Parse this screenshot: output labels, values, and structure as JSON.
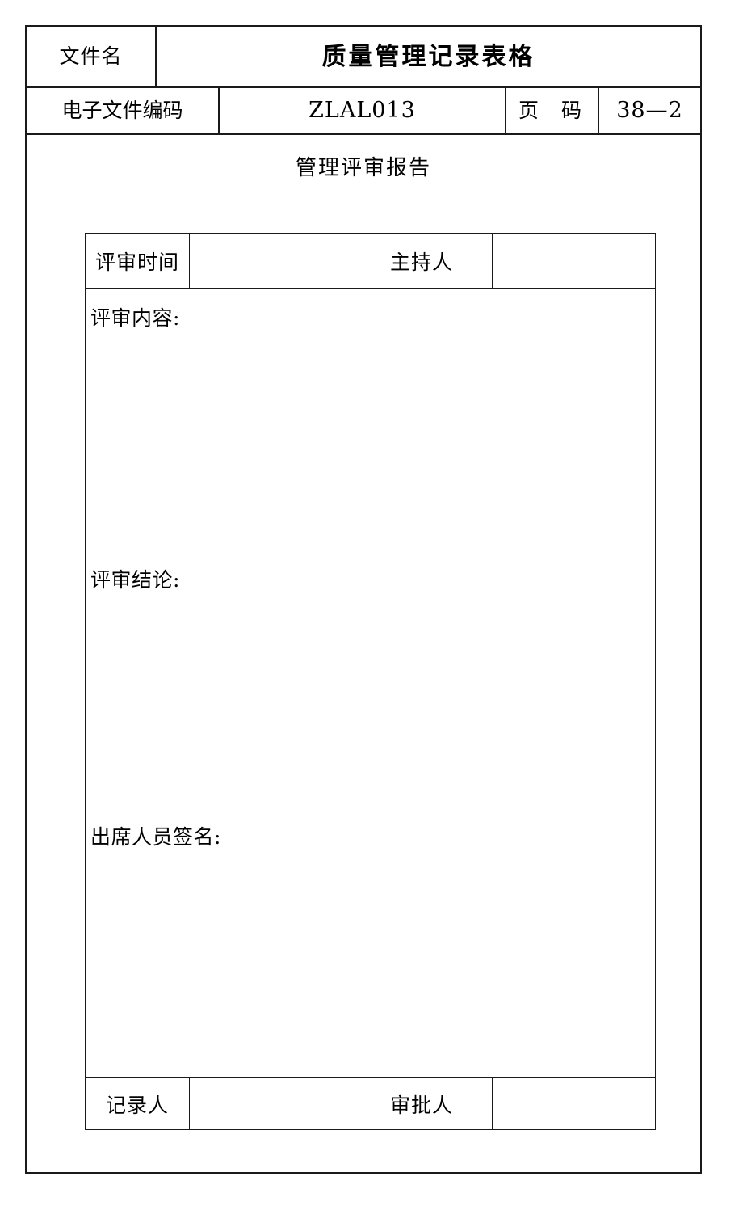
{
  "document": {
    "header": {
      "doc_name_label": "文件名",
      "doc_name_value": "质量管理记录表格",
      "code_label": "电子文件编码",
      "code_value": "ZLAL013",
      "page_label": "页 码",
      "page_label_first": "页",
      "page_label_second": "码",
      "page_value": "38—2"
    },
    "report_title": "管理评审报告",
    "form": {
      "review_time_label": "评审时间",
      "review_time_value": "",
      "host_label": "主持人",
      "host_value": "",
      "content_label": "评审内容:",
      "content_value": "",
      "conclusion_label": "评审结论:",
      "conclusion_value": "",
      "signature_label": "出席人员签名:",
      "signature_value": "",
      "recorder_label": "记录人",
      "recorder_value": "",
      "approver_label": "审批人",
      "approver_value": ""
    }
  },
  "colors": {
    "border": "#1a1a1a",
    "text": "#000000",
    "background": "#ffffff"
  }
}
